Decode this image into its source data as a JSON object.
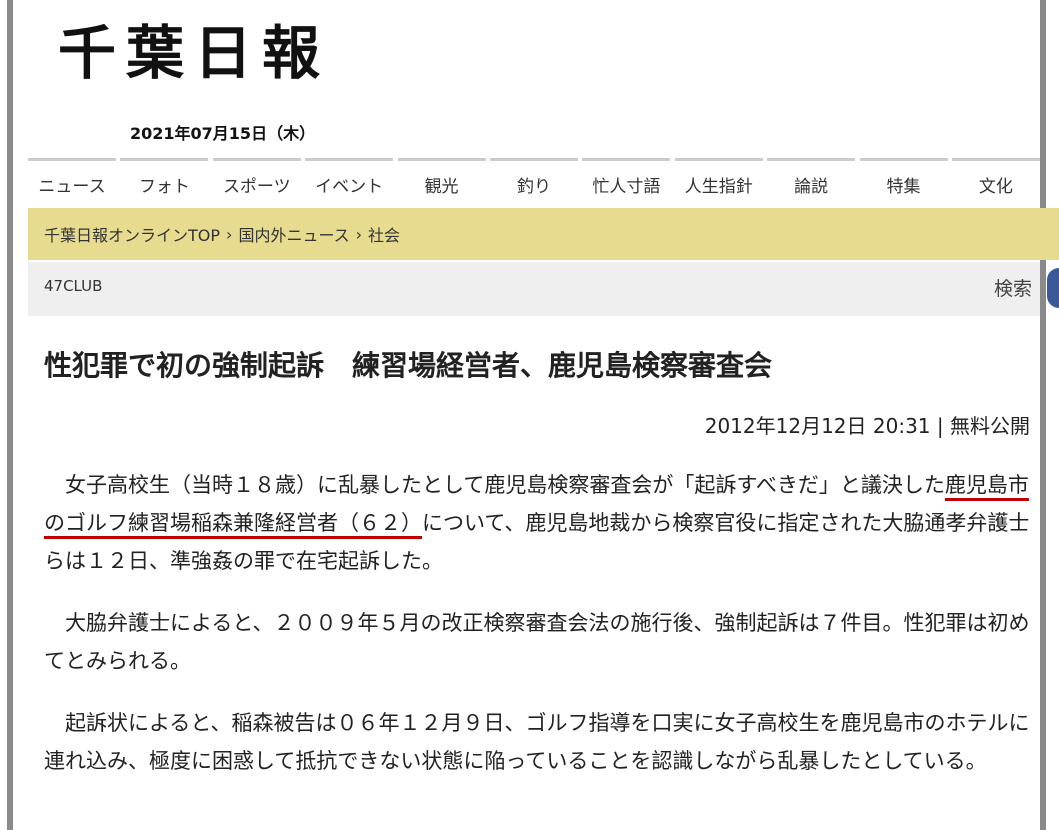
{
  "site": {
    "logo": "千葉日報",
    "date": "2021年07月15日（木）"
  },
  "nav": {
    "items": [
      {
        "label": "ニュース"
      },
      {
        "label": "フォト"
      },
      {
        "label": "スポーツ"
      },
      {
        "label": "イベント"
      },
      {
        "label": "観光"
      },
      {
        "label": "釣り"
      },
      {
        "label": "忙人寸語"
      },
      {
        "label": "人生指針"
      },
      {
        "label": "論説"
      },
      {
        "label": "特集"
      },
      {
        "label": "文化"
      }
    ]
  },
  "breadcrumb": {
    "items": [
      "千葉日報オンラインTOP",
      "国内外ニュース",
      "社会"
    ],
    "separator": "›"
  },
  "subbar": {
    "club": "47CLUB",
    "search": "検索"
  },
  "article": {
    "title": "性犯罪で初の強制起訴　練習場経営者、鹿児島検察審査会",
    "datetime": "2012年12月12日 20:31",
    "meta_sep": "|",
    "access": "無料公開",
    "p1_before": "女子高校生（当時１８歳）に乱暴したとして鹿児島検察審査会が「起訴すべきだ」と議決した",
    "p1_highlight": "鹿児島市のゴルフ練習場稲森兼隆経営者（６２）",
    "p1_after": "について、鹿児島地裁から検察官役に指定された大脇通孝弁護士らは１２日、準強姦の罪で在宅起訴した。",
    "p2": "大脇弁護士によると、２００９年５月の改正検察審査会法の施行後、強制起訴は７件目。性犯罪は初めてとみられる。",
    "p3": "起訴状によると、稲森被告は０６年１２月９日、ゴルフ指導を口実に女子高校生を鹿児島市のホテルに連れ込み、極度に困惑して抵抗できない状態に陥っていることを認識しながら乱暴したとしている。"
  },
  "colors": {
    "breadcrumb_bg": "#e6db8f",
    "subbar_bg": "#efefef",
    "highlight_underline": "#c00000",
    "frame_border": "#8a8a8a",
    "scroll_nub": "#3b5998"
  }
}
